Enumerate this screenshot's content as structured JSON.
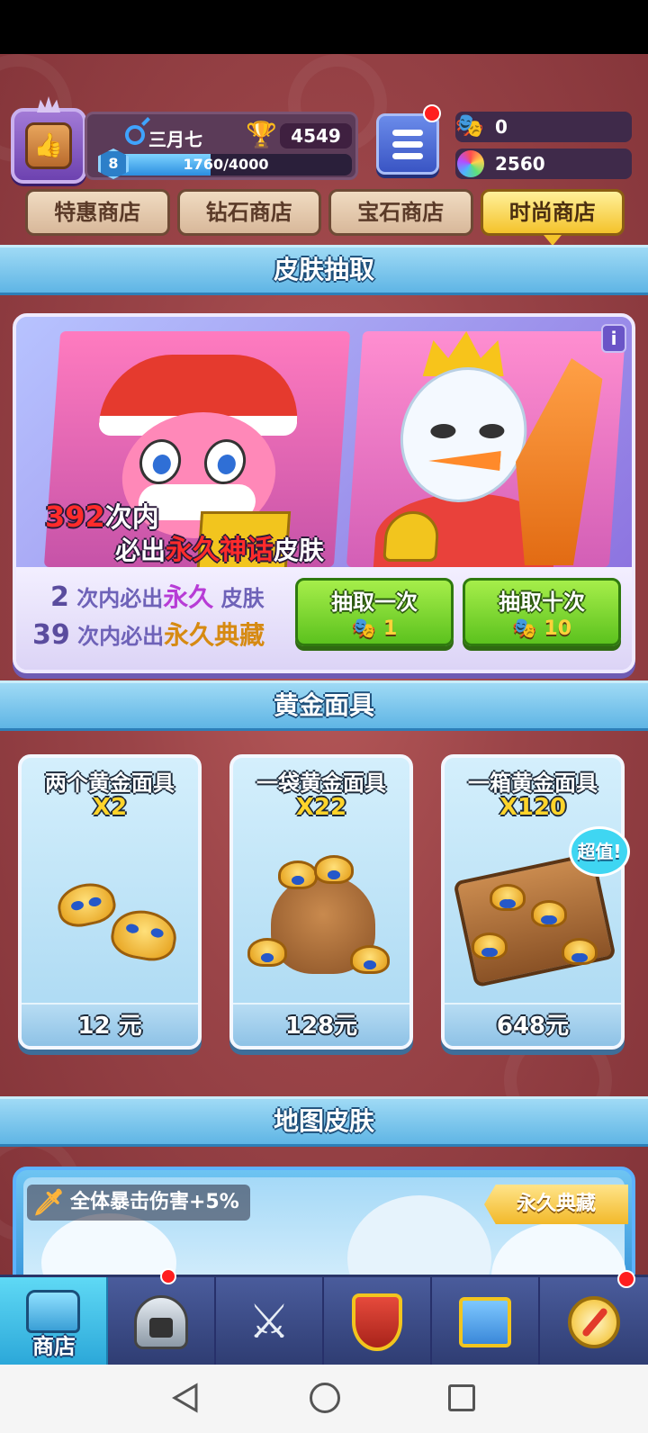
{
  "player": {
    "name": "三月七",
    "level": "8",
    "xp_text": "1760/4000",
    "xp_progress": 0.44,
    "trophies": "4549"
  },
  "currency": {
    "gold_masks": "0",
    "gems": "2560"
  },
  "tabs": [
    {
      "label": "特惠商店",
      "active": false
    },
    {
      "label": "钻石商店",
      "active": false
    },
    {
      "label": "宝石商店",
      "active": false
    },
    {
      "label": "时尚商店",
      "active": true
    }
  ],
  "skin_draw": {
    "section_title": "皮肤抽取",
    "headline_count": "392",
    "headline_part1": "次内",
    "headline_part2": "必出",
    "headline_highlight": "永久神话",
    "headline_suffix": "皮肤",
    "pity1_count": "2",
    "pity1_prefix": "次内必出",
    "pity1_highlight": "永久",
    "pity1_suffix": "皮肤",
    "pity2_count": "39",
    "pity2_prefix": "次内必出",
    "pity2_highlight": "永久典藏",
    "draw_once_label": "抽取一次",
    "draw_once_cost": "1",
    "draw_ten_label": "抽取十次",
    "draw_ten_cost": "10",
    "info_icon": "i"
  },
  "gold_masks": {
    "section_title": "黄金面具",
    "items": [
      {
        "title": "两个黄金面具",
        "quantity": "X2",
        "price": "12 元"
      },
      {
        "title": "一袋黄金面具",
        "quantity": "X22",
        "price": "128元"
      },
      {
        "title": "一箱黄金面具",
        "quantity": "X120",
        "price": "648元"
      }
    ],
    "value_badge": "超值!"
  },
  "map_skin": {
    "section_title": "地图皮肤",
    "buff": "全体暴击伤害+5%",
    "tag": "永久典藏"
  },
  "bottom_nav": {
    "shop_label": "商店",
    "icons": [
      "treasure-chest-icon",
      "helmet-icon",
      "crossed-swords-icon",
      "shield-crown-icon",
      "guild-banner-icon",
      "compass-icon"
    ]
  },
  "colors": {
    "accent_blue": "#5fb5e5",
    "draw_button_green": "#5cc21e",
    "notification_red": "#ff1e1e",
    "highlight_red": "#ff2b2b"
  }
}
